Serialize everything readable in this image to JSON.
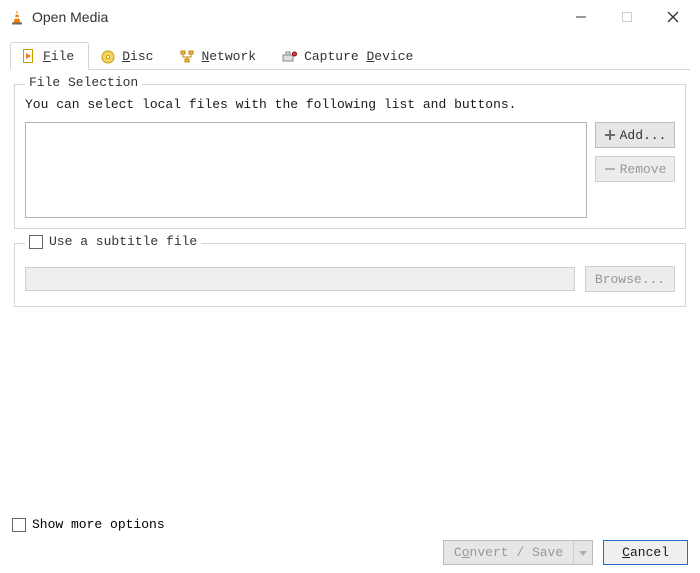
{
  "window": {
    "title": "Open Media"
  },
  "tabs": {
    "file": "File",
    "file_accel": "F",
    "disc": "Disc",
    "disc_accel": "D",
    "network": "Network",
    "network_accel": "N",
    "capture": "Capture Device",
    "capture_label_pre": "Capture ",
    "capture_accel": "D",
    "capture_label_post": "evice"
  },
  "file_group": {
    "legend": "File Selection",
    "hint": "You can select local files with the following list and buttons.",
    "add": "Add...",
    "remove": "Remove"
  },
  "subtitle_group": {
    "checkbox_label": "Use a subtitle file",
    "browse": "Browse..."
  },
  "footer": {
    "show_more": "Show more options",
    "convert": "Convert / Save",
    "cancel_accel": "C",
    "cancel_rest": "ancel"
  }
}
